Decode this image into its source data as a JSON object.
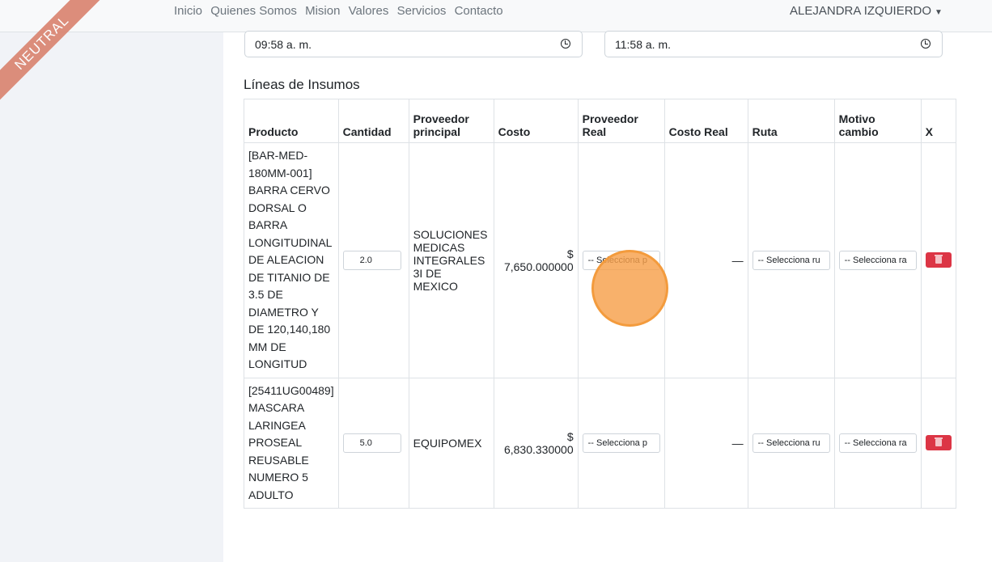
{
  "nav": {
    "links": [
      "Inicio",
      "Quienes Somos",
      "Mision",
      "Valores",
      "Servicios",
      "Contacto"
    ],
    "user": "ALEJANDRA IZQUIERDO"
  },
  "ribbon_text": "NEUTRAL",
  "times": {
    "start": "09:58 a. m.",
    "end": "11:58 a. m."
  },
  "section_title": "Líneas de Insumos",
  "table": {
    "headers": [
      "Producto",
      "Cantidad",
      "Proveedor principal",
      "Costo",
      "Proveedor Real",
      "Costo Real",
      "Ruta",
      "Motivo cambio",
      "X"
    ],
    "rows": [
      {
        "product": "[BAR-MED-180MM-001] BARRA CERVO DORSAL O BARRA LONGITUDINAL DE ALEACION DE TITANIO DE 3.5 DE DIAMETRO Y DE 120,140,180 MM DE LONGITUD",
        "quantity": "2.0",
        "supplier": "SOLUCIONES MEDICAS INTEGRALES 3I DE MEXICO",
        "cost": "$ 7,650.000000",
        "real_supplier_placeholder": "-- Selecciona p",
        "real_cost": "—",
        "route_placeholder": "-- Selecciona ru",
        "reason_placeholder": "-- Selecciona ra"
      },
      {
        "product": "[25411UG00489] MASCARA LARINGEA PROSEAL REUSABLE NUMERO 5 ADULTO",
        "quantity": "5.0",
        "supplier": "EQUIPOMEX",
        "cost": "$ 6,830.330000",
        "real_supplier_placeholder": "-- Selecciona p",
        "real_cost": "—",
        "route_placeholder": "-- Selecciona ru",
        "reason_placeholder": "-- Selecciona ra"
      }
    ]
  },
  "colors": {
    "delete": "#dc3545",
    "highlight": "#f7a04a"
  }
}
